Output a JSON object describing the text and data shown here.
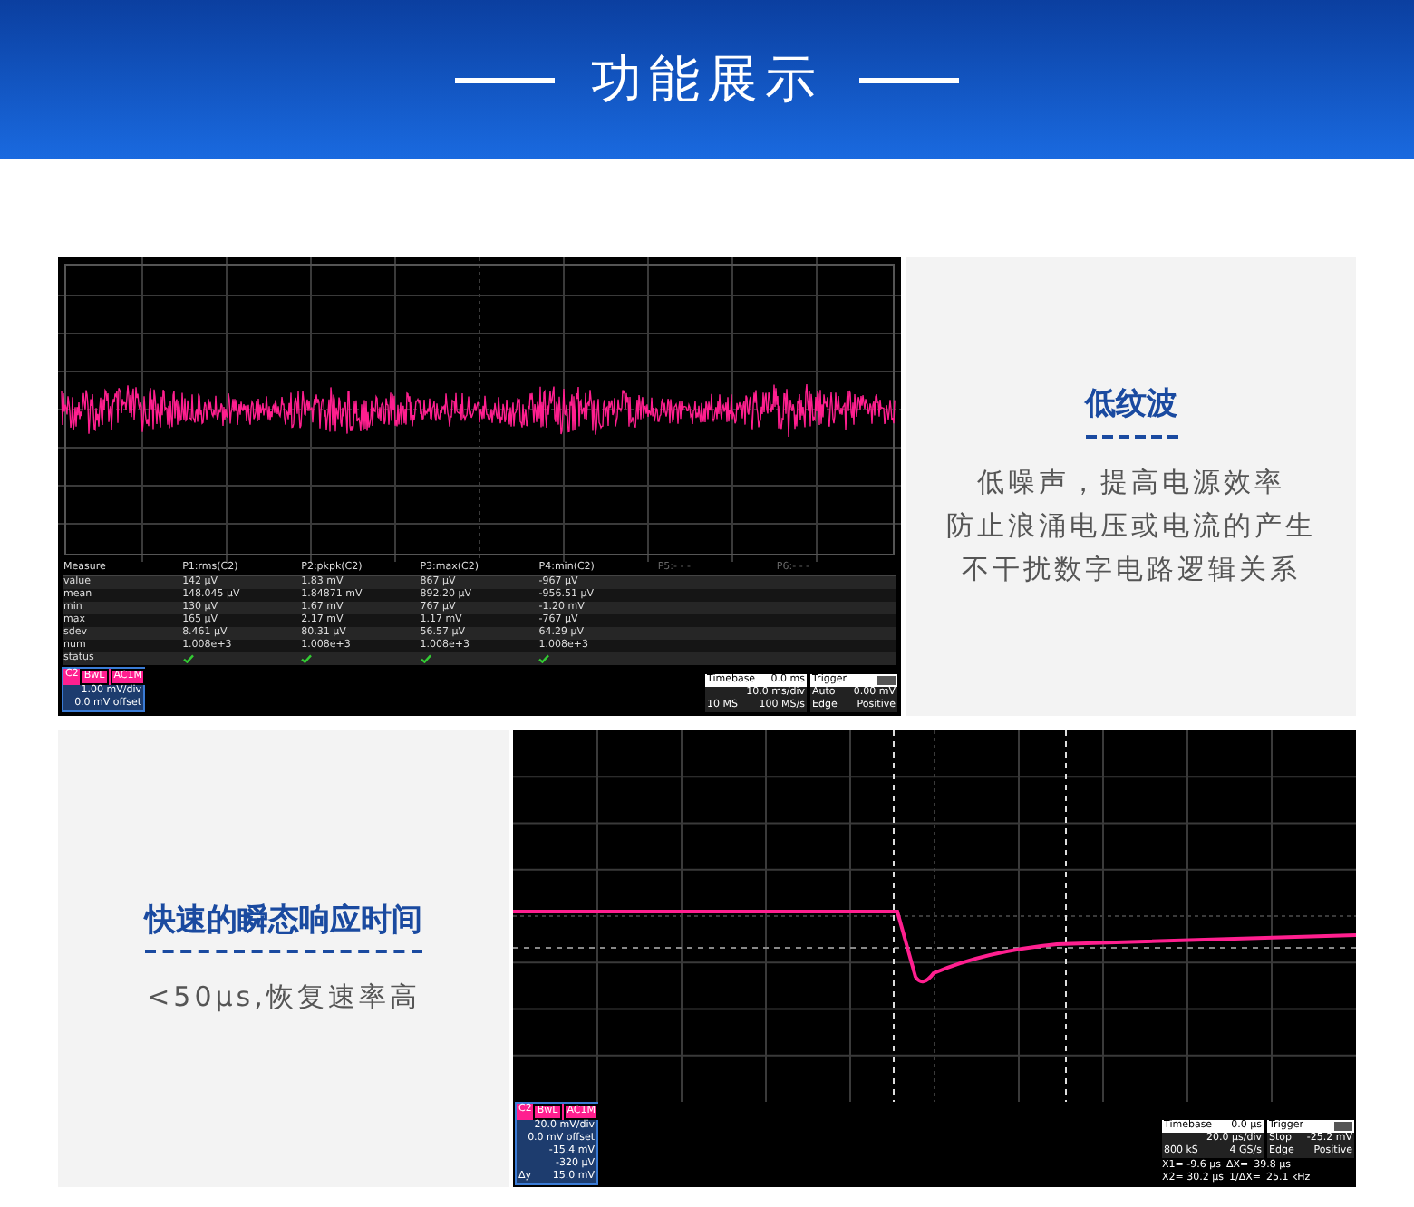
{
  "header": {
    "title": "功能展示"
  },
  "section_1": {
    "scope": {
      "measure_table": {
        "columns": [
          "Measure",
          "P1:rms(C2)",
          "P2:pkpk(C2)",
          "P3:max(C2)",
          "P4:min(C2)",
          "P5:- - -",
          "P6:- - -"
        ],
        "rows": [
          [
            "value",
            "142 μV",
            "1.83 mV",
            "867 μV",
            "-967 μV"
          ],
          [
            "mean",
            "148.045 μV",
            "1.84871 mV",
            "892.20 μV",
            "-956.51 μV"
          ],
          [
            "min",
            "130 μV",
            "1.67 mV",
            "767 μV",
            "-1.20 mV"
          ],
          [
            "max",
            "165 μV",
            "2.17 mV",
            "1.17 mV",
            "-767 μV"
          ],
          [
            "sdev",
            "8.461 μV",
            "80.31 μV",
            "56.57 μV",
            "64.29 μV"
          ],
          [
            "num",
            "1.008e+3",
            "1.008e+3",
            "1.008e+3",
            "1.008e+3"
          ]
        ],
        "status": {
          "label": "status",
          "passed": [
            true,
            true,
            true,
            true
          ]
        }
      },
      "channel": {
        "name": "C2",
        "tags": [
          "BwL",
          "AC1M"
        ],
        "lines": [
          "1.00 mV/div",
          "0.0 mV offset"
        ]
      },
      "timebase": {
        "label": "Timebase",
        "value": "0.0 ms",
        "rows": [
          [
            "",
            "10.0 ms/div"
          ],
          [
            "10 MS",
            "100 MS/s"
          ]
        ]
      },
      "trigger": {
        "label": "Trigger",
        "rows": [
          [
            "Auto",
            "0.00 mV"
          ],
          [
            "Edge",
            "Positive"
          ]
        ]
      }
    },
    "feature": {
      "title": "低纹波",
      "lines": [
        "低噪声，提高电源效率",
        "防止浪涌电压或电流的产生",
        "不干扰数字电路逻辑关系"
      ]
    }
  },
  "section_2": {
    "feature": {
      "title": "快速的瞬态响应时间",
      "lines": [
        "<50μs,恢复速率高"
      ]
    },
    "scope": {
      "channel": {
        "name": "C2",
        "tags": [
          "BwL",
          "AC1M"
        ],
        "lines": [
          "20.0 mV/div",
          "0.0 mV offset",
          "-15.4 mV",
          "-320 μV"
        ],
        "delta_label": "Δy",
        "delta_value": "15.0 mV"
      },
      "timebase": {
        "label": "Timebase",
        "value": "0.0 μs",
        "rows": [
          [
            "",
            "20.0 μs/div"
          ],
          [
            "800 kS",
            "4 GS/s"
          ]
        ]
      },
      "trigger": {
        "label": "Trigger",
        "rows": [
          [
            "Stop",
            "-25.2 mV"
          ],
          [
            "Edge",
            "Positive"
          ]
        ]
      },
      "cursors": [
        [
          "X1= -9.6 μs",
          "ΔX=",
          "39.8 μs"
        ],
        [
          "X2= 30.2 μs",
          "1/ΔX=",
          "25.1 kHz"
        ]
      ]
    }
  }
}
